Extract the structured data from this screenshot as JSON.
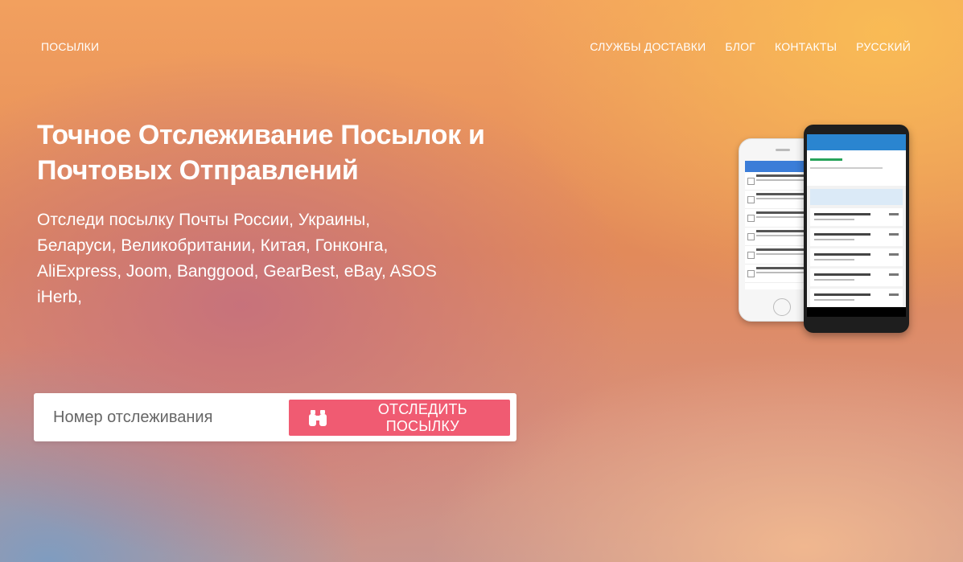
{
  "nav": {
    "brand": "ПОСЫЛКИ",
    "links": [
      "СЛУЖБЫ ДОСТАВКИ",
      "БЛОГ",
      "КОНТАКТЫ",
      "РУССКИЙ"
    ]
  },
  "hero": {
    "title_line1": "Точное Отслеживание Посылок и",
    "title_line2": "Почтовых Отправлений",
    "subtitle_lines": [
      "Отследи посылку Почты России, Украины,",
      "Беларуси, Великобритании, Китая, Гонконга,",
      "AliExpress, Joom, Banggood, GearBest, eBay, ASOS",
      "iHerb,"
    ]
  },
  "search": {
    "placeholder": "Номер отслеживания",
    "value": "",
    "button_label": "ОТСЛЕДИТЬ ПОСЫЛКУ",
    "button_color": "#f05b72",
    "button_icon": "binoculars-icon"
  },
  "colors": {
    "accent": "#f05b72",
    "text": "#ffffff"
  }
}
